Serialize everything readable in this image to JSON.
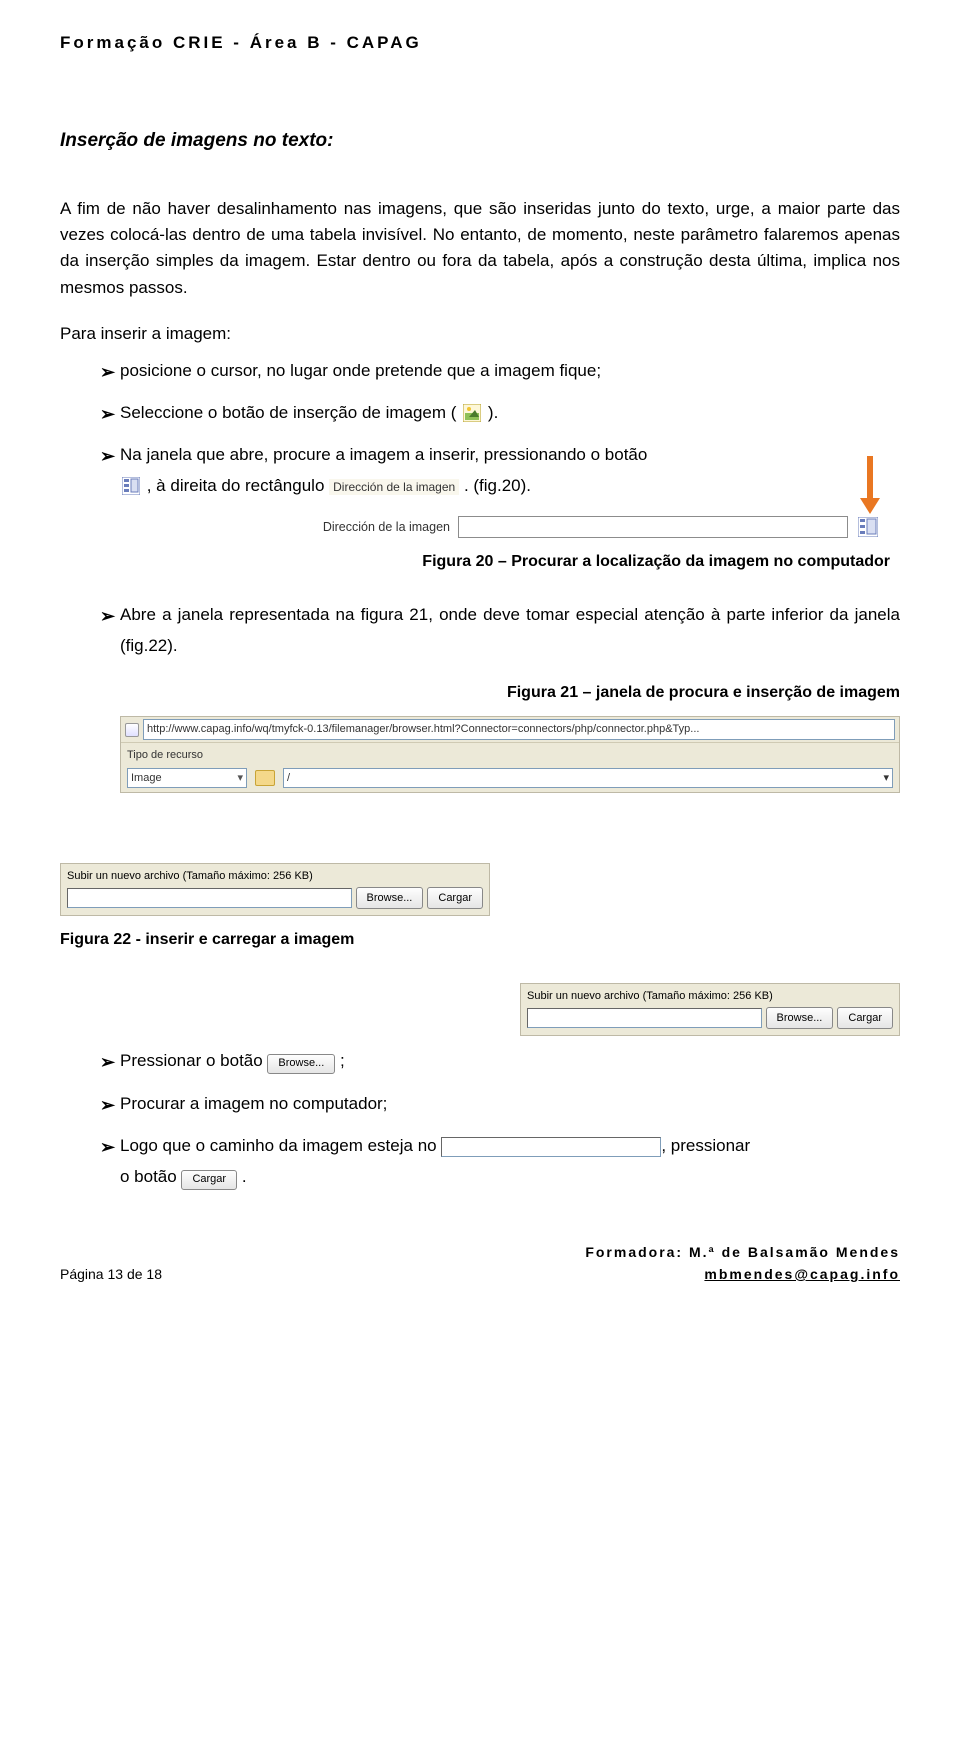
{
  "header": "Formação CRIE - Área B - CAPAG",
  "title": "Inserção de imagens no texto:",
  "p1": "A fim de não haver desalinhamento nas imagens, que são inseridas junto do texto, urge, a maior parte das vezes colocá-las dentro de uma tabela invisível. No entanto, de momento, neste parâmetro falaremos apenas da inserção simples da imagem. Estar dentro ou fora da tabela, após a construção desta última, implica nos mesmos passos.",
  "list_intro": "Para inserir a imagem:",
  "b1": "posicione o cursor, no lugar onde pretende que a imagem fique;",
  "b2a": "Seleccione o botão de inserção de imagem (",
  "b2b": ").",
  "b3a": "Na janela que abre, procure a imagem a inserir, pressionando o botão ",
  "b3b": ", à direita do rectângulo ",
  "b3c": ". (fig.20).",
  "fig20_label": "Dirección de la imagen",
  "fig20_input": "",
  "fig20_caption": "Figura 20 – Procurar a localização da imagem no computador",
  "b4": "Abre a janela representada na figura 21, onde deve tomar especial atenção à parte inferior da janela (fig.22).",
  "fig21_caption": "Figura 21 – janela de procura e inserção de imagem",
  "fig21": {
    "address": "http://www.capag.info/wq/tmyfck-0.13/filemanager/browser.html?Connector=connectors/php/connector.php&Typ...",
    "tool_label": "Tipo de recurso",
    "tool_value": "Image",
    "path": "/"
  },
  "upload": {
    "title": "Subir un nuevo archivo  (Tamaño máximo: 256 KB)",
    "browse": "Browse...",
    "cargar": "Cargar"
  },
  "fig22_caption": "Figura 22 - inserir e carregar a imagem",
  "b5a": "Pressionar o botão ",
  "b5b": ";",
  "b6": "Procurar a imagem no computador;",
  "b7a": "Logo que o caminho da imagem esteja no ",
  "b7b": ", pressionar",
  "b7c": "o botão ",
  "b7d": ".",
  "footer": {
    "page": "Página 13 de 18",
    "formadora": "Formadora: M.ª de Balsamão Mendes",
    "email": "mbmendes@capag.info"
  }
}
